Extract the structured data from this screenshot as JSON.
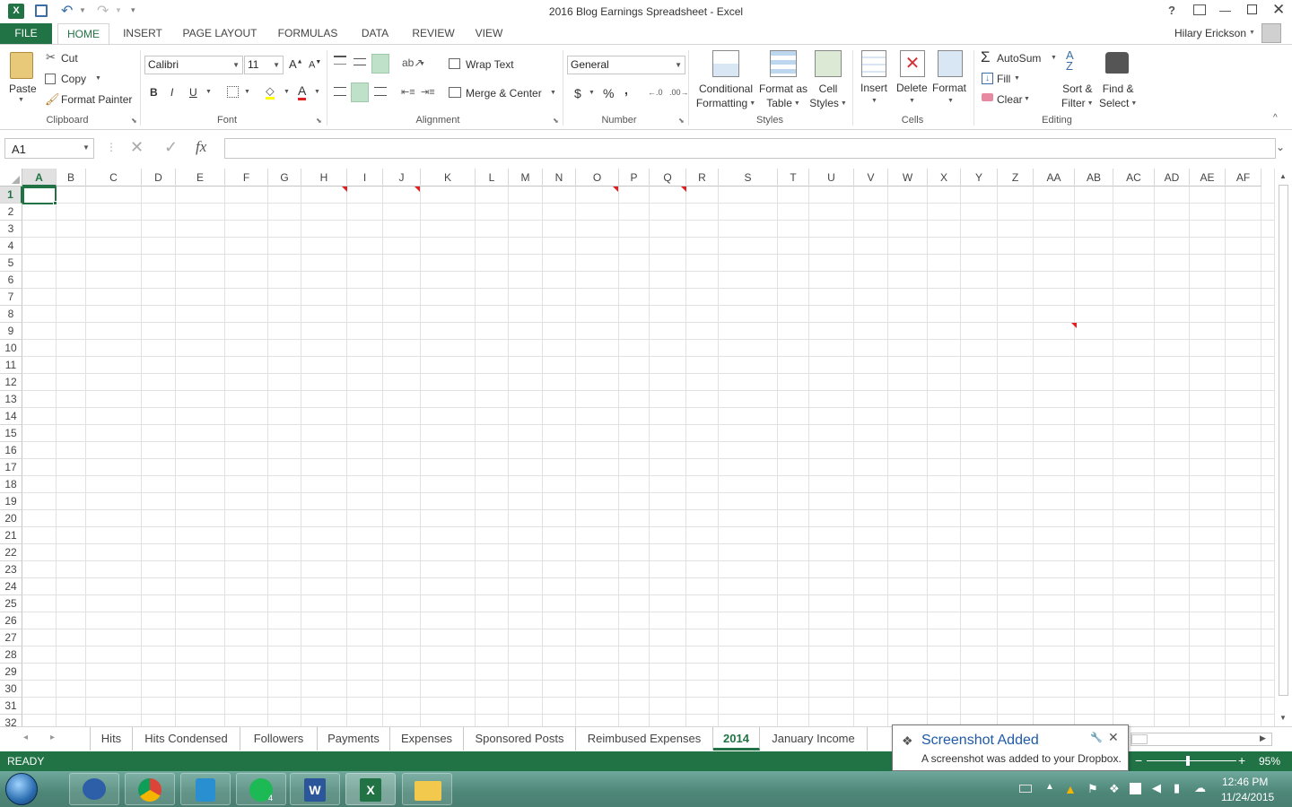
{
  "window": {
    "title": "2016 Blog Earnings Spreadsheet - Excel",
    "user": "Hilary Erickson"
  },
  "tabs": [
    "FILE",
    "HOME",
    "INSERT",
    "PAGE LAYOUT",
    "FORMULAS",
    "DATA",
    "REVIEW",
    "VIEW"
  ],
  "clipboard": {
    "paste": "Paste",
    "cut": "Cut",
    "copy": "Copy",
    "format_painter": "Format Painter",
    "label": "Clipboard"
  },
  "font": {
    "name": "Calibri",
    "size": "11",
    "bold": "B",
    "italic": "I",
    "underline": "U",
    "font_color": "A",
    "label": "Font"
  },
  "alignment": {
    "wrap": "Wrap Text",
    "merge": "Merge & Center",
    "label": "Alignment"
  },
  "number": {
    "format": "General",
    "currency": "$",
    "percent": "%",
    "comma": ",",
    "label": "Number"
  },
  "styles": {
    "conditional_1": "Conditional",
    "conditional_2": "Formatting",
    "format_table_1": "Format as",
    "format_table_2": "Table",
    "cell_styles_1": "Cell",
    "cell_styles_2": "Styles",
    "label": "Styles"
  },
  "cells": {
    "insert": "Insert",
    "delete": "Delete",
    "format": "Format",
    "label": "Cells"
  },
  "editing": {
    "autosum": "AutoSum",
    "fill": "Fill",
    "clear": "Clear",
    "sort_1": "Sort &",
    "sort_2": "Filter",
    "find_1": "Find &",
    "find_2": "Select",
    "label": "Editing"
  },
  "formula_bar": {
    "name_box": "A1",
    "fx": "fx",
    "value": ""
  },
  "columns": [
    "A",
    "B",
    "C",
    "D",
    "E",
    "F",
    "G",
    "H",
    "I",
    "J",
    "K",
    "L",
    "M",
    "N",
    "O",
    "P",
    "Q",
    "R",
    "S",
    "T",
    "U",
    "V",
    "W",
    "X",
    "Y",
    "Z",
    "AA",
    "AB",
    "AC",
    "AD",
    "AE",
    "AF"
  ],
  "rows": [
    "1",
    "2",
    "3",
    "4",
    "5",
    "6",
    "7",
    "8",
    "9",
    "10",
    "11",
    "12",
    "13",
    "14",
    "15",
    "16",
    "17",
    "18",
    "19",
    "20",
    "21",
    "22",
    "23",
    "24",
    "25",
    "26",
    "27",
    "28",
    "29",
    "30",
    "31",
    "32"
  ],
  "sheets": [
    "Hits",
    "Hits Condensed",
    "Followers",
    "Payments",
    "Expenses",
    "Sponsored Posts",
    "Reimbused Expenses",
    "2014",
    "January Income"
  ],
  "active_sheet": "2014",
  "status": {
    "ready": "READY",
    "zoom": "95%",
    "zoom_minus": "−",
    "zoom_plus": "+"
  },
  "toast": {
    "title": "Screenshot Added",
    "message": "A screenshot was added to your Dropbox."
  },
  "taskbar": {
    "time": "12:46 PM",
    "date": "11/24/2015",
    "spotify_badge": "4"
  },
  "colors": {
    "excel_green": "#217346",
    "active_tab": "#217346",
    "comment": "#e02020"
  }
}
